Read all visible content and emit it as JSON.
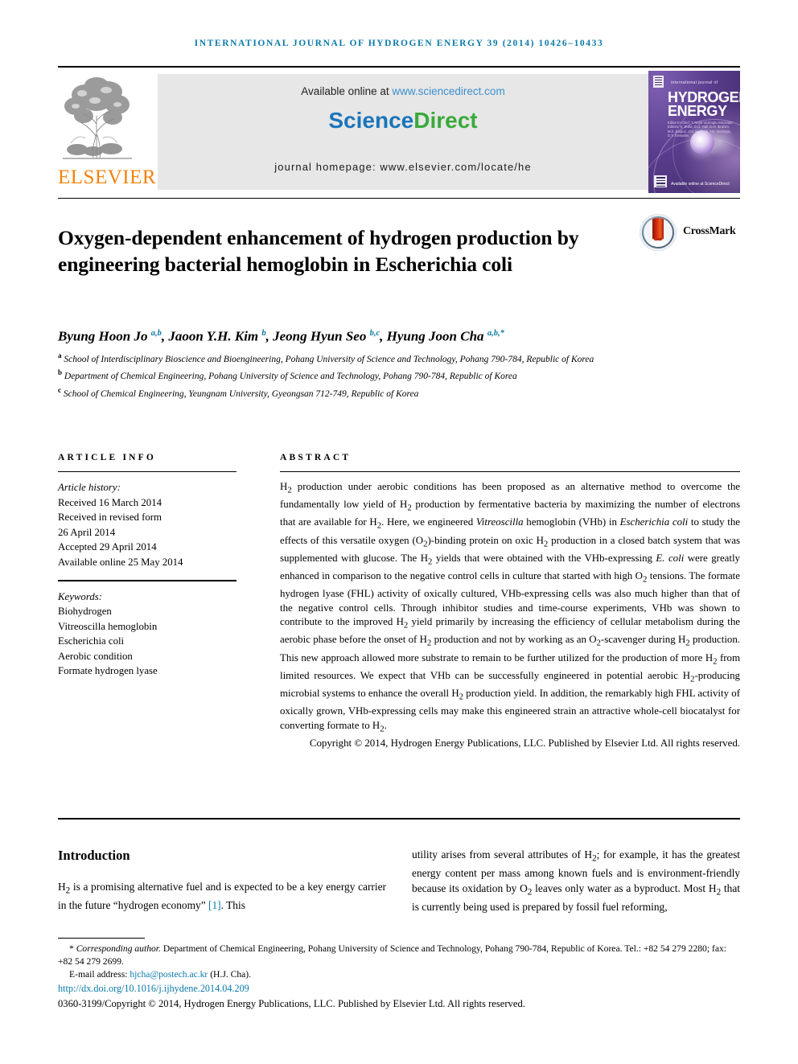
{
  "running_head": "International Journal of Hydrogen Energy 39 (2014) 10426–10433",
  "masthead": {
    "elsevier_wordmark": "ELSEVIER",
    "available_prefix": "Available online at ",
    "available_url": "www.sciencedirect.com",
    "sciencedirect_part1": "Science",
    "sciencedirect_part2": "Direct",
    "journal_homepage": "journal homepage: www.elsevier.com/locate/he",
    "cover": {
      "eyebrow": "international journal of",
      "line1": "HYDROGEN",
      "line2": "ENERGY",
      "editors": "Editor-in-Chief: T. Nejat Veziroglu\nAssociate Editors: S. Dutta, D.O. Hall, B.M. Ibrahim,\nM.Z. Karpuz, J.M. Norbeck,\nT.N. Veziroglu, D.Y. Goswami",
      "sciencedirect": "Available online at\nScienceDirect"
    }
  },
  "article": {
    "title": "Oxygen-dependent enhancement of hydrogen production by engineering bacterial hemoglobin in Escherichia coli",
    "crossmark_label": "CrossMark",
    "authors_html": "Byung Hoon Jo <sup>a,b</sup>, Jaoon Y.H. Kim <sup>b</sup>, Jeong Hyun Seo <sup>b,c</sup>, Hyung Joon Cha <sup>a,b,</sup><sup>*</sup>",
    "affiliations": [
      {
        "marker": "a",
        "text": "School of Interdisciplinary Bioscience and Bioengineering, Pohang University of Science and Technology, Pohang 790-784, Republic of Korea"
      },
      {
        "marker": "b",
        "text": "Department of Chemical Engineering, Pohang University of Science and Technology, Pohang 790-784, Republic of Korea"
      },
      {
        "marker": "c",
        "text": "School of Chemical Engineering, Yeungnam University, Gyeongsan 712-749, Republic of Korea"
      }
    ]
  },
  "article_info": {
    "heading": "ARTICLE INFO",
    "history_label": "Article history:",
    "history": [
      "Received 16 March 2014",
      "Received in revised form",
      "26 April 2014",
      "Accepted 29 April 2014",
      "Available online 25 May 2014"
    ],
    "keywords_label": "Keywords:",
    "keywords": [
      "Biohydrogen",
      "Vitreoscilla hemoglobin",
      "Escherichia coli",
      "Aerobic condition",
      "Formate hydrogen lyase"
    ]
  },
  "abstract": {
    "heading": "ABSTRACT",
    "body_html": "H<sub>2</sub> production under aerobic conditions has been proposed as an alternative method to overcome the fundamentally low yield of H<sub>2</sub> production by fermentative bacteria by maximizing the number of electrons that are available for H<sub>2</sub>. Here, we engineered <i>Vitreoscilla</i> hemoglobin (VHb) in <i>Escherichia coli</i> to study the effects of this versatile oxygen (O<sub>2</sub>)-binding protein on oxic H<sub>2</sub> production in a closed batch system that was supplemented with glucose. The H<sub>2</sub> yields that were obtained with the VHb-expressing <i>E. coli</i> were greatly enhanced in comparison to the negative control cells in culture that started with high O<sub>2</sub> tensions. The formate hydrogen lyase (FHL) activity of oxically cultured, VHb-expressing cells was also much higher than that of the negative control cells. Through inhibitor studies and time-course experiments, VHb was shown to contribute to the improved H<sub>2</sub> yield primarily by increasing the efficiency of cellular metabolism during the aerobic phase before the onset of H<sub>2</sub> production and not by working as an O<sub>2</sub>-scavenger during H<sub>2</sub> production. This new approach allowed more substrate to remain to be further utilized for the production of more H<sub>2</sub> from limited resources. We expect that VHb can be successfully engineered in potential aerobic H<sub>2</sub>-producing microbial systems to enhance the overall H<sub>2</sub> production yield. In addition, the remarkably high FHL activity of oxically grown, VHb-expressing cells may make this engineered strain an attractive whole-cell biocatalyst for converting formate to H<sub>2</sub>.",
    "copyright_html": "Copyright &copy; 2014, Hydrogen Energy Publications, LLC. Published by Elsevier Ltd. All rights reserved."
  },
  "body": {
    "intro_heading": "Introduction",
    "left_col_html": "H<sub>2</sub> is a promising alternative fuel and is expected to be a key energy carrier in the future “hydrogen economy” <span class=\"ref\">[1]</span>. This",
    "right_col_html": "utility arises from several attributes of H<sub>2</sub>; for example, it has the greatest energy content per mass among known fuels and is environment-friendly because its oxidation by O<sub>2</sub> leaves only water as a byproduct. Most H<sub>2</sub> that is currently being used is prepared by fossil fuel reforming,"
  },
  "footer": {
    "corresponding_html": "<span class=\"ind\"></span>* <span class=\"it\">Corresponding author.</span> Department of Chemical Engineering, Pohang University of Science and Technology, Pohang 790-784, Republic of Korea. Tel.: +82 54 279 2280; fax: +82 54 279 2699.",
    "email_prefix": "E-mail address: ",
    "email": "hjcha@postech.ac.kr",
    "email_suffix": " (H.J. Cha).",
    "doi": "http://dx.doi.org/10.1016/j.ijhydene.2014.04.209",
    "issn_copyright_html": "0360-3199/Copyright &copy; 2014, Hydrogen Energy Publications, LLC. Published by Elsevier Ltd. All rights reserved."
  },
  "colors": {
    "accent_blue": "#0b7aa8",
    "elsevier_orange": "#f2820a",
    "sciencedirect_blue": "#1b75bb",
    "sciencedirect_green": "#3aa93a",
    "panel_gray": "#e7e7e7"
  }
}
